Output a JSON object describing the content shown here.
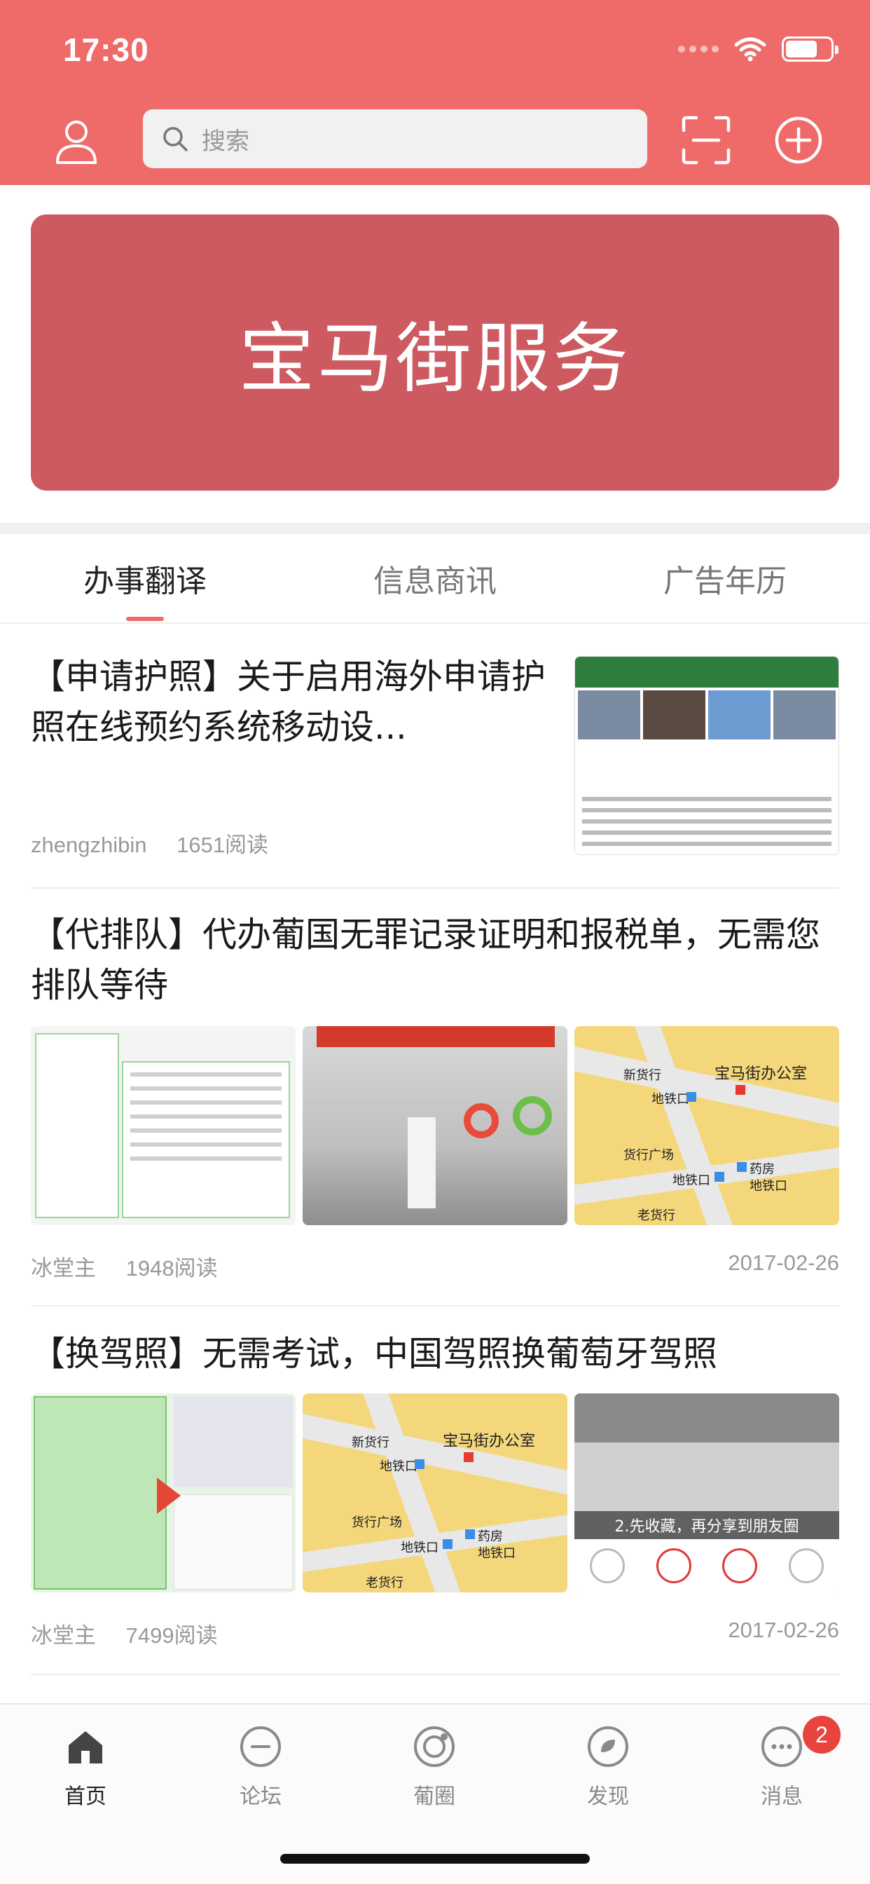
{
  "status_bar": {
    "time": "17:30"
  },
  "search": {
    "placeholder": "搜索"
  },
  "banner": {
    "title": "宝马街服务"
  },
  "tabs": [
    {
      "label": "办事翻译",
      "active": true
    },
    {
      "label": "信息商讯",
      "active": false
    },
    {
      "label": "广告年历",
      "active": false
    }
  ],
  "articles": [
    {
      "title": "【申请护照】关于启用海外申请护照在线预约系统移动设...",
      "author": "zhengzhibin",
      "reads": "1651阅读",
      "date": ""
    },
    {
      "title": "【代排队】代办葡国无罪记录证明和报税单，无需您排队等待",
      "author": "冰堂主",
      "reads": "1948阅读",
      "date": "2017-02-26",
      "map_labels": [
        "新货行",
        "宝马街办公室",
        "地铁口",
        "货行广场",
        "地铁口",
        "药房",
        "地铁口",
        "老货行"
      ]
    },
    {
      "title": "【换驾照】无需考试，中国驾照换葡萄牙驾照",
      "author": "冰堂主",
      "reads": "7499阅读",
      "date": "2017-02-26",
      "share_band": "2.先收藏，再分享到朋友圈"
    }
  ],
  "bottom_nav": [
    {
      "label": "首页",
      "icon": "home-icon",
      "active": true
    },
    {
      "label": "论坛",
      "icon": "forum-icon",
      "active": false
    },
    {
      "label": "葡圈",
      "icon": "circle-icon",
      "active": false
    },
    {
      "label": "发现",
      "icon": "discover-icon",
      "active": false
    },
    {
      "label": "消息",
      "icon": "message-icon",
      "active": false
    }
  ],
  "message_badge": "2",
  "colors": {
    "brand": "#ee6b6a",
    "banner": "#cd5a60",
    "badge": "#e8433c"
  }
}
